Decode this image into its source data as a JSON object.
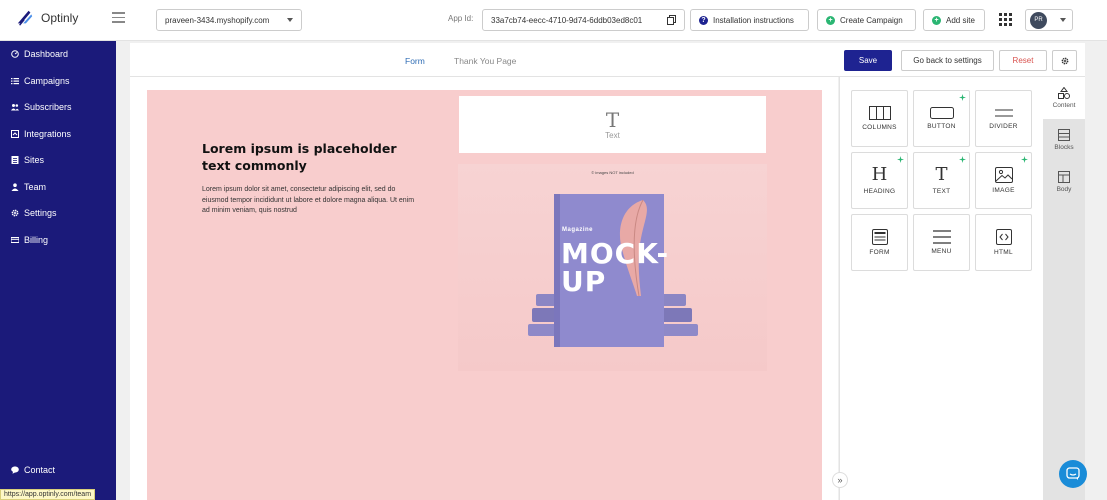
{
  "app": {
    "name": "Optinly"
  },
  "topbar": {
    "store": "praveen-3434.myshopify.com",
    "app_id_label": "App Id:",
    "app_id": "33a7cb74-eecc-4710-9d74-6ddb03ed8c01",
    "installation_label": "Installation instructions",
    "create_campaign_label": "Create Campaign",
    "add_site_label": "Add site",
    "avatar_initials": "PR"
  },
  "sidebar": {
    "items": [
      {
        "label": "Dashboard",
        "icon": "dashboard-icon"
      },
      {
        "label": "Campaigns",
        "icon": "list-icon"
      },
      {
        "label": "Subscribers",
        "icon": "users-icon"
      },
      {
        "label": "Integrations",
        "icon": "integrations-icon"
      },
      {
        "label": "Sites",
        "icon": "sites-icon"
      },
      {
        "label": "Team",
        "icon": "user-icon"
      },
      {
        "label": "Settings",
        "icon": "gear-icon"
      },
      {
        "label": "Billing",
        "icon": "card-icon"
      }
    ],
    "contact_label": "Contact"
  },
  "status_bar": {
    "url": "https://app.optinly.com/team"
  },
  "editor": {
    "tabs": [
      {
        "label": "Form"
      },
      {
        "label": "Thank You Page"
      }
    ],
    "save_label": "Save",
    "back_label": "Go back to settings",
    "reset_label": "Reset"
  },
  "canvas": {
    "text_block_label": "Text",
    "headline": "Lorem ipsum is placeholder text commonly",
    "body": "Lorem ipsum dolor sit amet, consectetur adipiscing elit, sed do eiusmod tempor incididunt ut labore et dolore magna aliqua. Ut enim ad minim veniam, quis nostrud",
    "mockup": {
      "caption": "© images NOT included",
      "magazine_label": "Magazine",
      "title": "MOCK-UP"
    }
  },
  "tools": [
    {
      "label": "COLUMNS",
      "icon": "columns-icon",
      "spark": false
    },
    {
      "label": "BUTTON",
      "icon": "button-icon",
      "spark": true
    },
    {
      "label": "DIVIDER",
      "icon": "divider-icon",
      "spark": false
    },
    {
      "label": "HEADING",
      "icon": "heading-icon",
      "spark": true
    },
    {
      "label": "TEXT",
      "icon": "text-icon",
      "spark": true
    },
    {
      "label": "IMAGE",
      "icon": "image-icon",
      "spark": true
    },
    {
      "label": "FORM",
      "icon": "form-icon",
      "spark": false
    },
    {
      "label": "MENU",
      "icon": "menu-icon",
      "spark": false
    },
    {
      "label": "HTML",
      "icon": "html-icon",
      "spark": false
    }
  ],
  "side_tabs": [
    {
      "label": "Content",
      "icon": "shapes-icon",
      "active": true
    },
    {
      "label": "Blocks",
      "icon": "blocks-icon",
      "active": false
    },
    {
      "label": "Body",
      "icon": "body-icon",
      "active": false
    }
  ],
  "colors": {
    "sidebar_bg": "#1b1a7a",
    "primary": "#1e2391",
    "popup_bg": "#f8cdcd",
    "reset": "#d9534f",
    "accent_green": "#2bb673",
    "tab_active": "#2f6db5"
  }
}
